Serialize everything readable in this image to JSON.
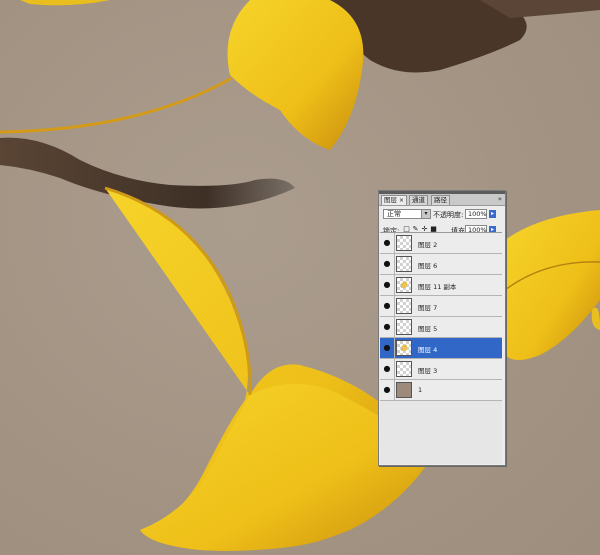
{
  "panel": {
    "tabs": [
      {
        "label": "图层",
        "active": true,
        "close": "×"
      },
      {
        "label": "通道",
        "active": false
      },
      {
        "label": "路径",
        "active": false
      }
    ],
    "menu_arrow": "»",
    "blend_mode": "正常",
    "opacity_label": "不透明度:",
    "opacity_value": "100%",
    "lock_label": "锁定:",
    "fill_label": "填充:",
    "fill_value": "100%",
    "layers": [
      {
        "name": "图层 2",
        "selected": false
      },
      {
        "name": "图层 6",
        "selected": false
      },
      {
        "name": "图层 11 副本",
        "selected": false
      },
      {
        "name": "图层 7",
        "selected": false
      },
      {
        "name": "图层 5",
        "selected": false
      },
      {
        "name": "图层 4",
        "selected": true
      },
      {
        "name": "图层 3",
        "selected": false
      },
      {
        "name": "1",
        "selected": false
      }
    ]
  },
  "colors": {
    "background": "#a89a8b",
    "leaf_yellow": "#f2c71c",
    "leaf_dark": "#d49a10",
    "branch": "#4a3a2c",
    "selected_row": "#3168c8"
  }
}
